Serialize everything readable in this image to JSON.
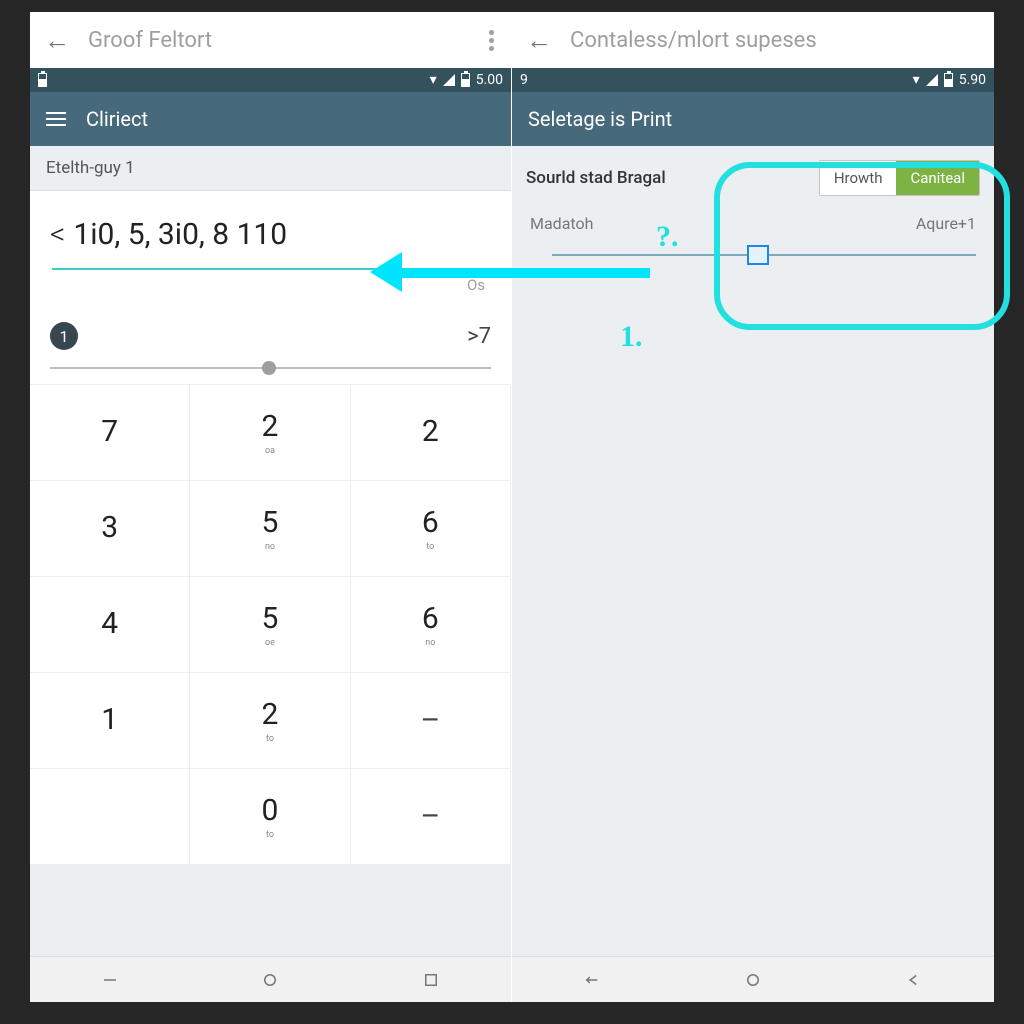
{
  "left": {
    "topnav_title": "Groof Feltort",
    "status_time": "5.00",
    "appbar_title": "Cliriect",
    "section_label": "Etelth-guy 1",
    "display_lt": "<",
    "display_value": "1i0, 5, 3i0, 8 110",
    "display_sub": "Os",
    "slider_badge": "1",
    "slider_right": ">7",
    "keys": [
      {
        "main": "7",
        "sub": ""
      },
      {
        "main": "2",
        "sub": "oa"
      },
      {
        "main": "2",
        "sub": ""
      },
      {
        "main": "3",
        "sub": ""
      },
      {
        "main": "5",
        "sub": "no"
      },
      {
        "main": "6",
        "sub": "to"
      },
      {
        "main": "4",
        "sub": ""
      },
      {
        "main": "5",
        "sub": "oe"
      },
      {
        "main": "6",
        "sub": "no"
      },
      {
        "main": "1",
        "sub": ""
      },
      {
        "main": "2",
        "sub": "to"
      },
      {
        "main": "–",
        "sub": ""
      },
      {
        "main": "",
        "sub": ""
      },
      {
        "main": "0",
        "sub": "to"
      },
      {
        "main": "–",
        "sub": ""
      }
    ]
  },
  "right": {
    "topnav_title": "Contaless/mlort supeses",
    "status_left": "9",
    "status_time": "5.90",
    "appbar_title": "Seletage is Print",
    "row_label": "Sourld stad Bragal",
    "toggle_a": "Hrowth",
    "toggle_b": "Caniteal",
    "row3_left": "Madatoh",
    "row3_right": "Aqure+1"
  },
  "annotations": {
    "marker_1": "?.",
    "marker_2": "1."
  },
  "colors": {
    "accent": "#46697b",
    "highlight": "#00e5ff",
    "green": "#7cb342"
  }
}
